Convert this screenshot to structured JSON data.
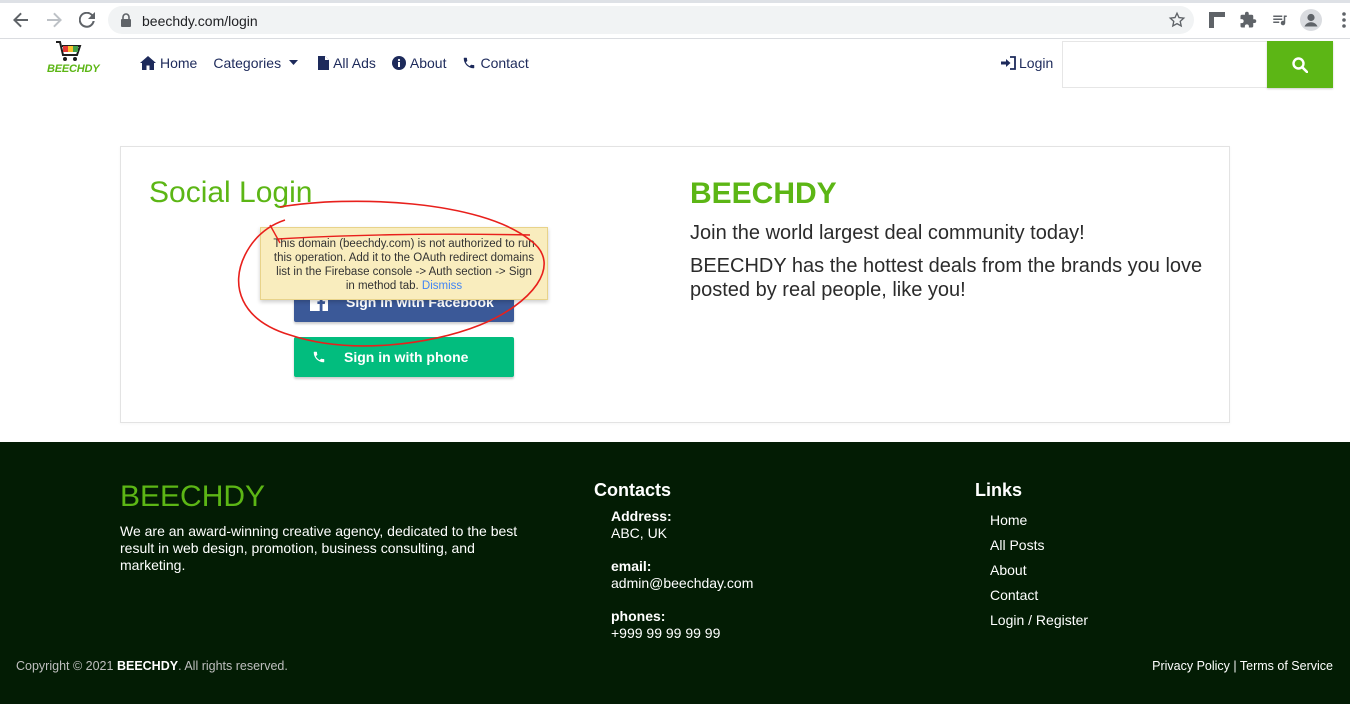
{
  "browser": {
    "url": "beechdy.com/login"
  },
  "header": {
    "logo_text": "BEECHDY",
    "nav": {
      "home": "Home",
      "categories": "Categories",
      "all_ads": "All Ads",
      "about": "About",
      "contact": "Contact"
    },
    "login": "Login",
    "search_value": ""
  },
  "login": {
    "title": "Social Login",
    "facebook_button": "Sign in with Facebook",
    "phone_button": "Sign in with phone",
    "error_message": "This domain (beechdy.com) is not authorized to run this operation. Add it to the OAuth redirect domains list in the Firebase console -> Auth section -> Sign in method tab.",
    "dismiss": "Dismiss",
    "annotation_color": "#e8201c"
  },
  "brand": {
    "title": "BEECHDY",
    "line1": "Join the world largest deal community today!",
    "line2": "BEECHDY has the hottest deals from the brands you love posted by real people, like you!"
  },
  "footer": {
    "brand": "BEECHDY",
    "description": "We are an award-winning creative agency, dedicated to the best result in web design, promotion, business consulting, and marketing.",
    "contacts_heading": "Contacts",
    "address_label": "Address:",
    "address_value": "ABC, UK",
    "email_label": "email:",
    "email_value": "admin@beechday.com",
    "phones_label": "phones:",
    "phones_value": "+999 99 99 99 99",
    "links_heading": "Links",
    "links": [
      "Home",
      "All Posts",
      "About",
      "Contact",
      "Login / Register"
    ],
    "copyright_prefix": "Copyright © 2021",
    "copyright_brand": "BEECHDY",
    "copyright_suffix": ". All rights reserved.",
    "privacy": "Privacy Policy",
    "separator": "|",
    "terms": "Terms of Service"
  },
  "colors": {
    "brand_green": "#5cb615",
    "footer_bg": "#031c04",
    "facebook_blue": "#3b5998",
    "phone_green": "#02bd7e",
    "nav_text": "#1d2a5b"
  }
}
